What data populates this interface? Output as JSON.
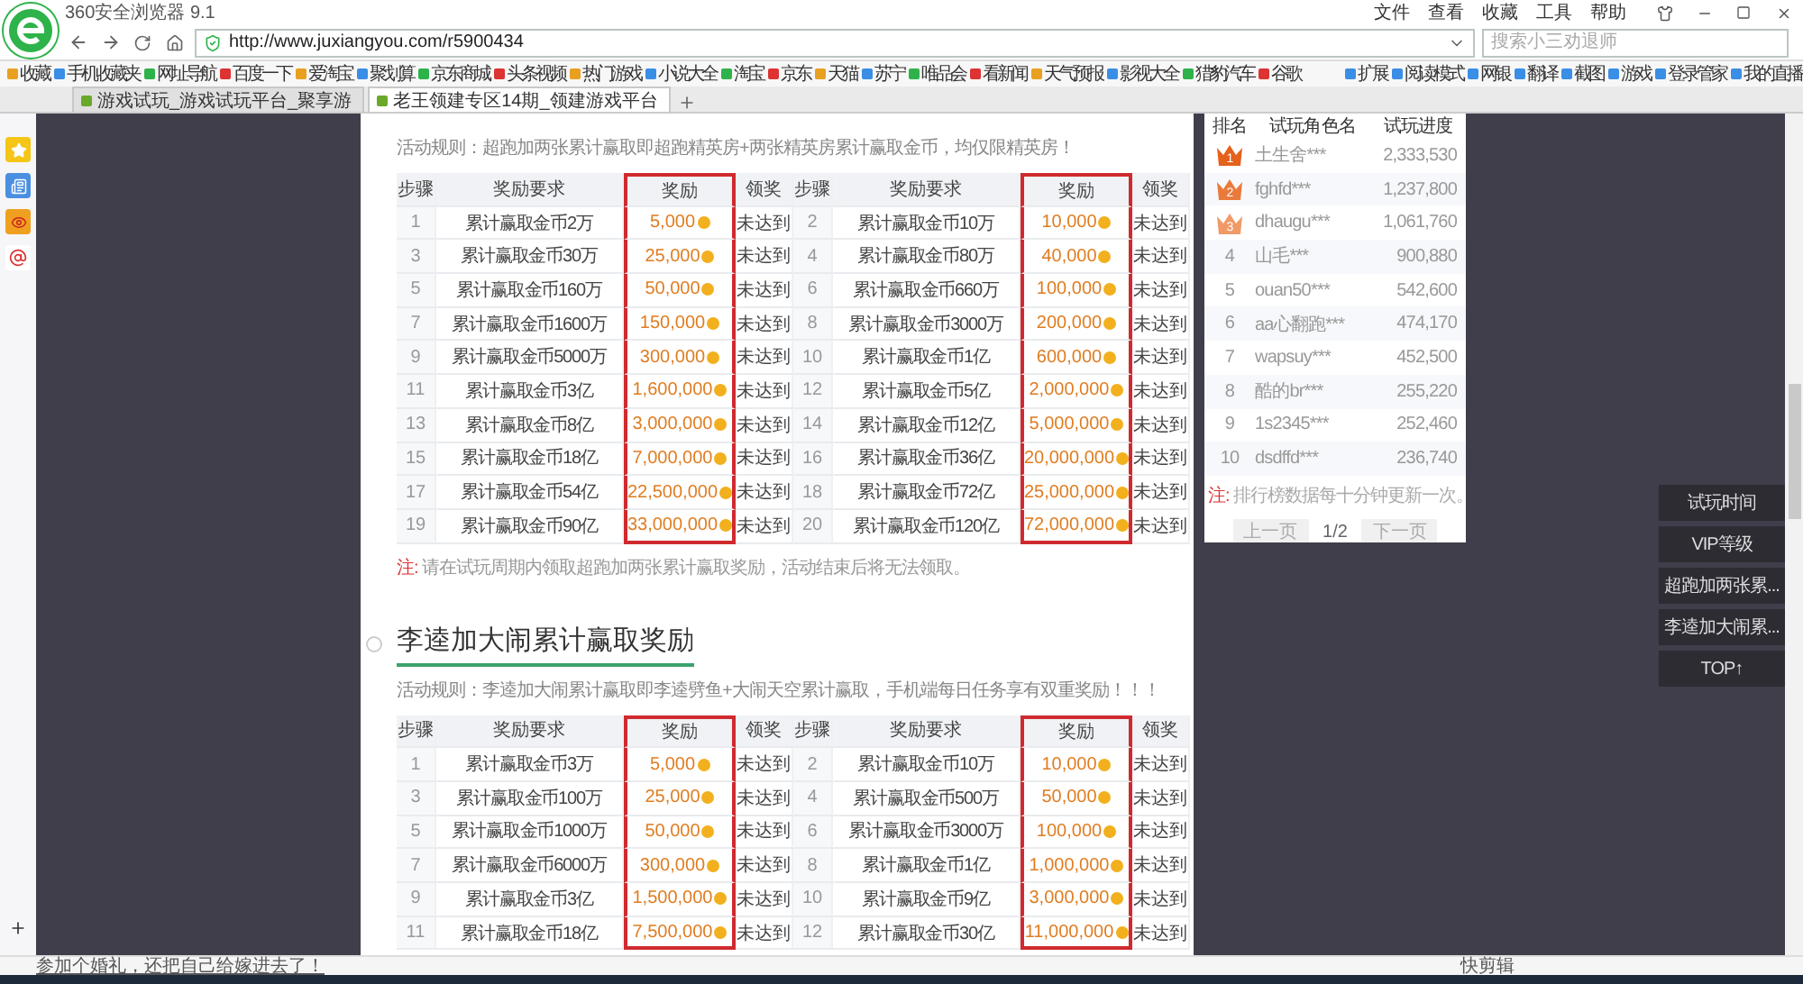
{
  "browser": {
    "title": "360安全浏览器 9.1",
    "menu": [
      "文件",
      "查看",
      "收藏",
      "工具",
      "帮助"
    ],
    "url": "http://www.juxiangyou.com/r5900434",
    "search_placeholder": "搜索小三劝退师",
    "bookmarks": [
      "收藏",
      "手机收藏夹",
      "网址导航",
      "百度一下",
      "爱淘宝",
      "聚划算",
      "京东商城",
      "头条视频",
      "热门游戏",
      "小说大全",
      "淘宝",
      "京东",
      "天猫",
      "苏宁",
      "唯品会",
      "看新闻",
      "天气预报",
      "影视大全",
      "猎豹汽车",
      "谷歌"
    ],
    "bookmarks_right": [
      "扩展",
      "阅读模式",
      "网银",
      "翻译",
      "截图",
      "游戏",
      "登录管家",
      "我的直播"
    ],
    "tabs": [
      {
        "label": "游戏试玩_游戏试玩平台_聚享游",
        "selected": false
      },
      {
        "label": "老王领建专区14期_领建游戏平台",
        "selected": true
      }
    ]
  },
  "sections": [
    {
      "rule": "活动规则：超跑加两张累计赢取即超跑精英房+两张精英房累计赢取金币，均仅限精英房！",
      "columns": [
        {
          "label": "步骤",
          "highlighted": false
        },
        {
          "label": "奖励要求",
          "highlighted": false
        },
        {
          "label": "奖励",
          "highlighted": true
        },
        {
          "label": "领奖",
          "highlighted": false
        },
        {
          "label": "步骤",
          "highlighted": false
        },
        {
          "label": "奖励要求",
          "highlighted": false
        },
        {
          "label": "奖励",
          "highlighted": true
        },
        {
          "label": "领奖",
          "highlighted": false
        }
      ],
      "rows": [
        {
          "left": {
            "step": "1",
            "requirement": "累计赢取金币2万",
            "reward": "5,000",
            "status": "未达到"
          },
          "right": {
            "step": "2",
            "requirement": "累计赢取金币10万",
            "reward": "10,000",
            "status": "未达到"
          }
        },
        {
          "left": {
            "step": "3",
            "requirement": "累计赢取金币30万",
            "reward": "25,000",
            "status": "未达到"
          },
          "right": {
            "step": "4",
            "requirement": "累计赢取金币80万",
            "reward": "40,000",
            "status": "未达到"
          }
        },
        {
          "left": {
            "step": "5",
            "requirement": "累计赢取金币160万",
            "reward": "50,000",
            "status": "未达到"
          },
          "right": {
            "step": "6",
            "requirement": "累计赢取金币660万",
            "reward": "100,000",
            "status": "未达到"
          }
        },
        {
          "left": {
            "step": "7",
            "requirement": "累计赢取金币1600万",
            "reward": "150,000",
            "status": "未达到"
          },
          "right": {
            "step": "8",
            "requirement": "累计赢取金币3000万",
            "reward": "200,000",
            "status": "未达到"
          }
        },
        {
          "left": {
            "step": "9",
            "requirement": "累计赢取金币5000万",
            "reward": "300,000",
            "status": "未达到"
          },
          "right": {
            "step": "10",
            "requirement": "累计赢取金币1亿",
            "reward": "600,000",
            "status": "未达到"
          }
        },
        {
          "left": {
            "step": "11",
            "requirement": "累计赢取金币3亿",
            "reward": "1,600,000",
            "status": "未达到"
          },
          "right": {
            "step": "12",
            "requirement": "累计赢取金币5亿",
            "reward": "2,000,000",
            "status": "未达到"
          }
        },
        {
          "left": {
            "step": "13",
            "requirement": "累计赢取金币8亿",
            "reward": "3,000,000",
            "status": "未达到"
          },
          "right": {
            "step": "14",
            "requirement": "累计赢取金币12亿",
            "reward": "5,000,000",
            "status": "未达到"
          }
        },
        {
          "left": {
            "step": "15",
            "requirement": "累计赢取金币18亿",
            "reward": "7,000,000",
            "status": "未达到"
          },
          "right": {
            "step": "16",
            "requirement": "累计赢取金币36亿",
            "reward": "20,000,000",
            "status": "未达到"
          }
        },
        {
          "left": {
            "step": "17",
            "requirement": "累计赢取金币54亿",
            "reward": "22,500,000",
            "status": "未达到"
          },
          "right": {
            "step": "18",
            "requirement": "累计赢取金币72亿",
            "reward": "25,000,000",
            "status": "未达到"
          }
        },
        {
          "left": {
            "step": "19",
            "requirement": "累计赢取金币90亿",
            "reward": "33,000,000",
            "status": "未达到"
          },
          "right": {
            "step": "20",
            "requirement": "累计赢取金币120亿",
            "reward": "72,000,000",
            "status": "未达到"
          }
        }
      ],
      "note": "请在试玩周期内领取超跑加两张累计赢取奖励，活动结束后将无法领取。",
      "note_mark": "注:"
    },
    {
      "title": "李逵加大闹累计赢取奖励",
      "rule": "活动规则：李逵加大闹累计赢取即李逵劈鱼+大闹天空累计赢取，手机端每日任务享有双重奖励！！！",
      "columns": [
        {
          "label": "步骤",
          "highlighted": false
        },
        {
          "label": "奖励要求",
          "highlighted": false
        },
        {
          "label": "奖励",
          "highlighted": true
        },
        {
          "label": "领奖",
          "highlighted": false
        },
        {
          "label": "步骤",
          "highlighted": false
        },
        {
          "label": "奖励要求",
          "highlighted": false
        },
        {
          "label": "奖励",
          "highlighted": true
        },
        {
          "label": "领奖",
          "highlighted": false
        }
      ],
      "rows": [
        {
          "left": {
            "step": "1",
            "requirement": "累计赢取金币3万",
            "reward": "5,000",
            "status": "未达到"
          },
          "right": {
            "step": "2",
            "requirement": "累计赢取金币10万",
            "reward": "10,000",
            "status": "未达到"
          }
        },
        {
          "left": {
            "step": "3",
            "requirement": "累计赢取金币100万",
            "reward": "25,000",
            "status": "未达到"
          },
          "right": {
            "step": "4",
            "requirement": "累计赢取金币500万",
            "reward": "50,000",
            "status": "未达到"
          }
        },
        {
          "left": {
            "step": "5",
            "requirement": "累计赢取金币1000万",
            "reward": "50,000",
            "status": "未达到"
          },
          "right": {
            "step": "6",
            "requirement": "累计赢取金币3000万",
            "reward": "100,000",
            "status": "未达到"
          }
        },
        {
          "left": {
            "step": "7",
            "requirement": "累计赢取金币6000万",
            "reward": "300,000",
            "status": "未达到"
          },
          "right": {
            "step": "8",
            "requirement": "累计赢取金币1亿",
            "reward": "1,000,000",
            "status": "未达到"
          }
        },
        {
          "left": {
            "step": "9",
            "requirement": "累计赢取金币3亿",
            "reward": "1,500,000",
            "status": "未达到"
          },
          "right": {
            "step": "10",
            "requirement": "累计赢取金币9亿",
            "reward": "3,000,000",
            "status": "未达到"
          }
        },
        {
          "left": {
            "step": "11",
            "requirement": "累计赢取金币18亿",
            "reward": "7,500,000",
            "status": "未达到"
          },
          "right": {
            "step": "12",
            "requirement": "累计赢取金币30亿",
            "reward": "11,000,000",
            "status": "未达到"
          }
        }
      ]
    }
  ],
  "ranking": {
    "columns": [
      "排名",
      "试玩角色名",
      "试玩进度"
    ],
    "rows": [
      {
        "rank": "1",
        "name": "土生舍***",
        "progress": "2,333,530",
        "kind": "crown",
        "color": "#e4621c"
      },
      {
        "rank": "2",
        "name": "fghfd***",
        "progress": "1,237,800",
        "kind": "crown",
        "color": "#ea7a3c"
      },
      {
        "rank": "3",
        "name": "dhaugu***",
        "progress": "1,061,760",
        "kind": "crown",
        "color": "#f09a68"
      },
      {
        "rank": "4",
        "name": "山毛***",
        "progress": "900,880",
        "kind": "plain"
      },
      {
        "rank": "5",
        "name": "ouan50***",
        "progress": "542,600",
        "kind": "plain"
      },
      {
        "rank": "6",
        "name": "aa心翻跑***",
        "progress": "474,170",
        "kind": "plain"
      },
      {
        "rank": "7",
        "name": "wapsuy***",
        "progress": "452,500",
        "kind": "plain"
      },
      {
        "rank": "8",
        "name": "酷的br***",
        "progress": "255,220",
        "kind": "plain"
      },
      {
        "rank": "9",
        "name": "1s2345***",
        "progress": "252,460",
        "kind": "plain"
      },
      {
        "rank": "10",
        "name": "dsdffd***",
        "progress": "236,740",
        "kind": "plain"
      }
    ],
    "note_mark": "注:",
    "note": "排行榜数据每十分钟更新一次。",
    "prev": "上一页",
    "page": "1/2",
    "next": "下一页"
  },
  "float_nav": [
    "试玩时间",
    "VIP等级",
    "超跑加两张累...",
    "李逵加大闹累...",
    "TOP↑"
  ],
  "status_bar": {
    "message": "参加个婚礼，还把自己给嫁进去了！",
    "items": [
      "快剪辑"
    ]
  }
}
